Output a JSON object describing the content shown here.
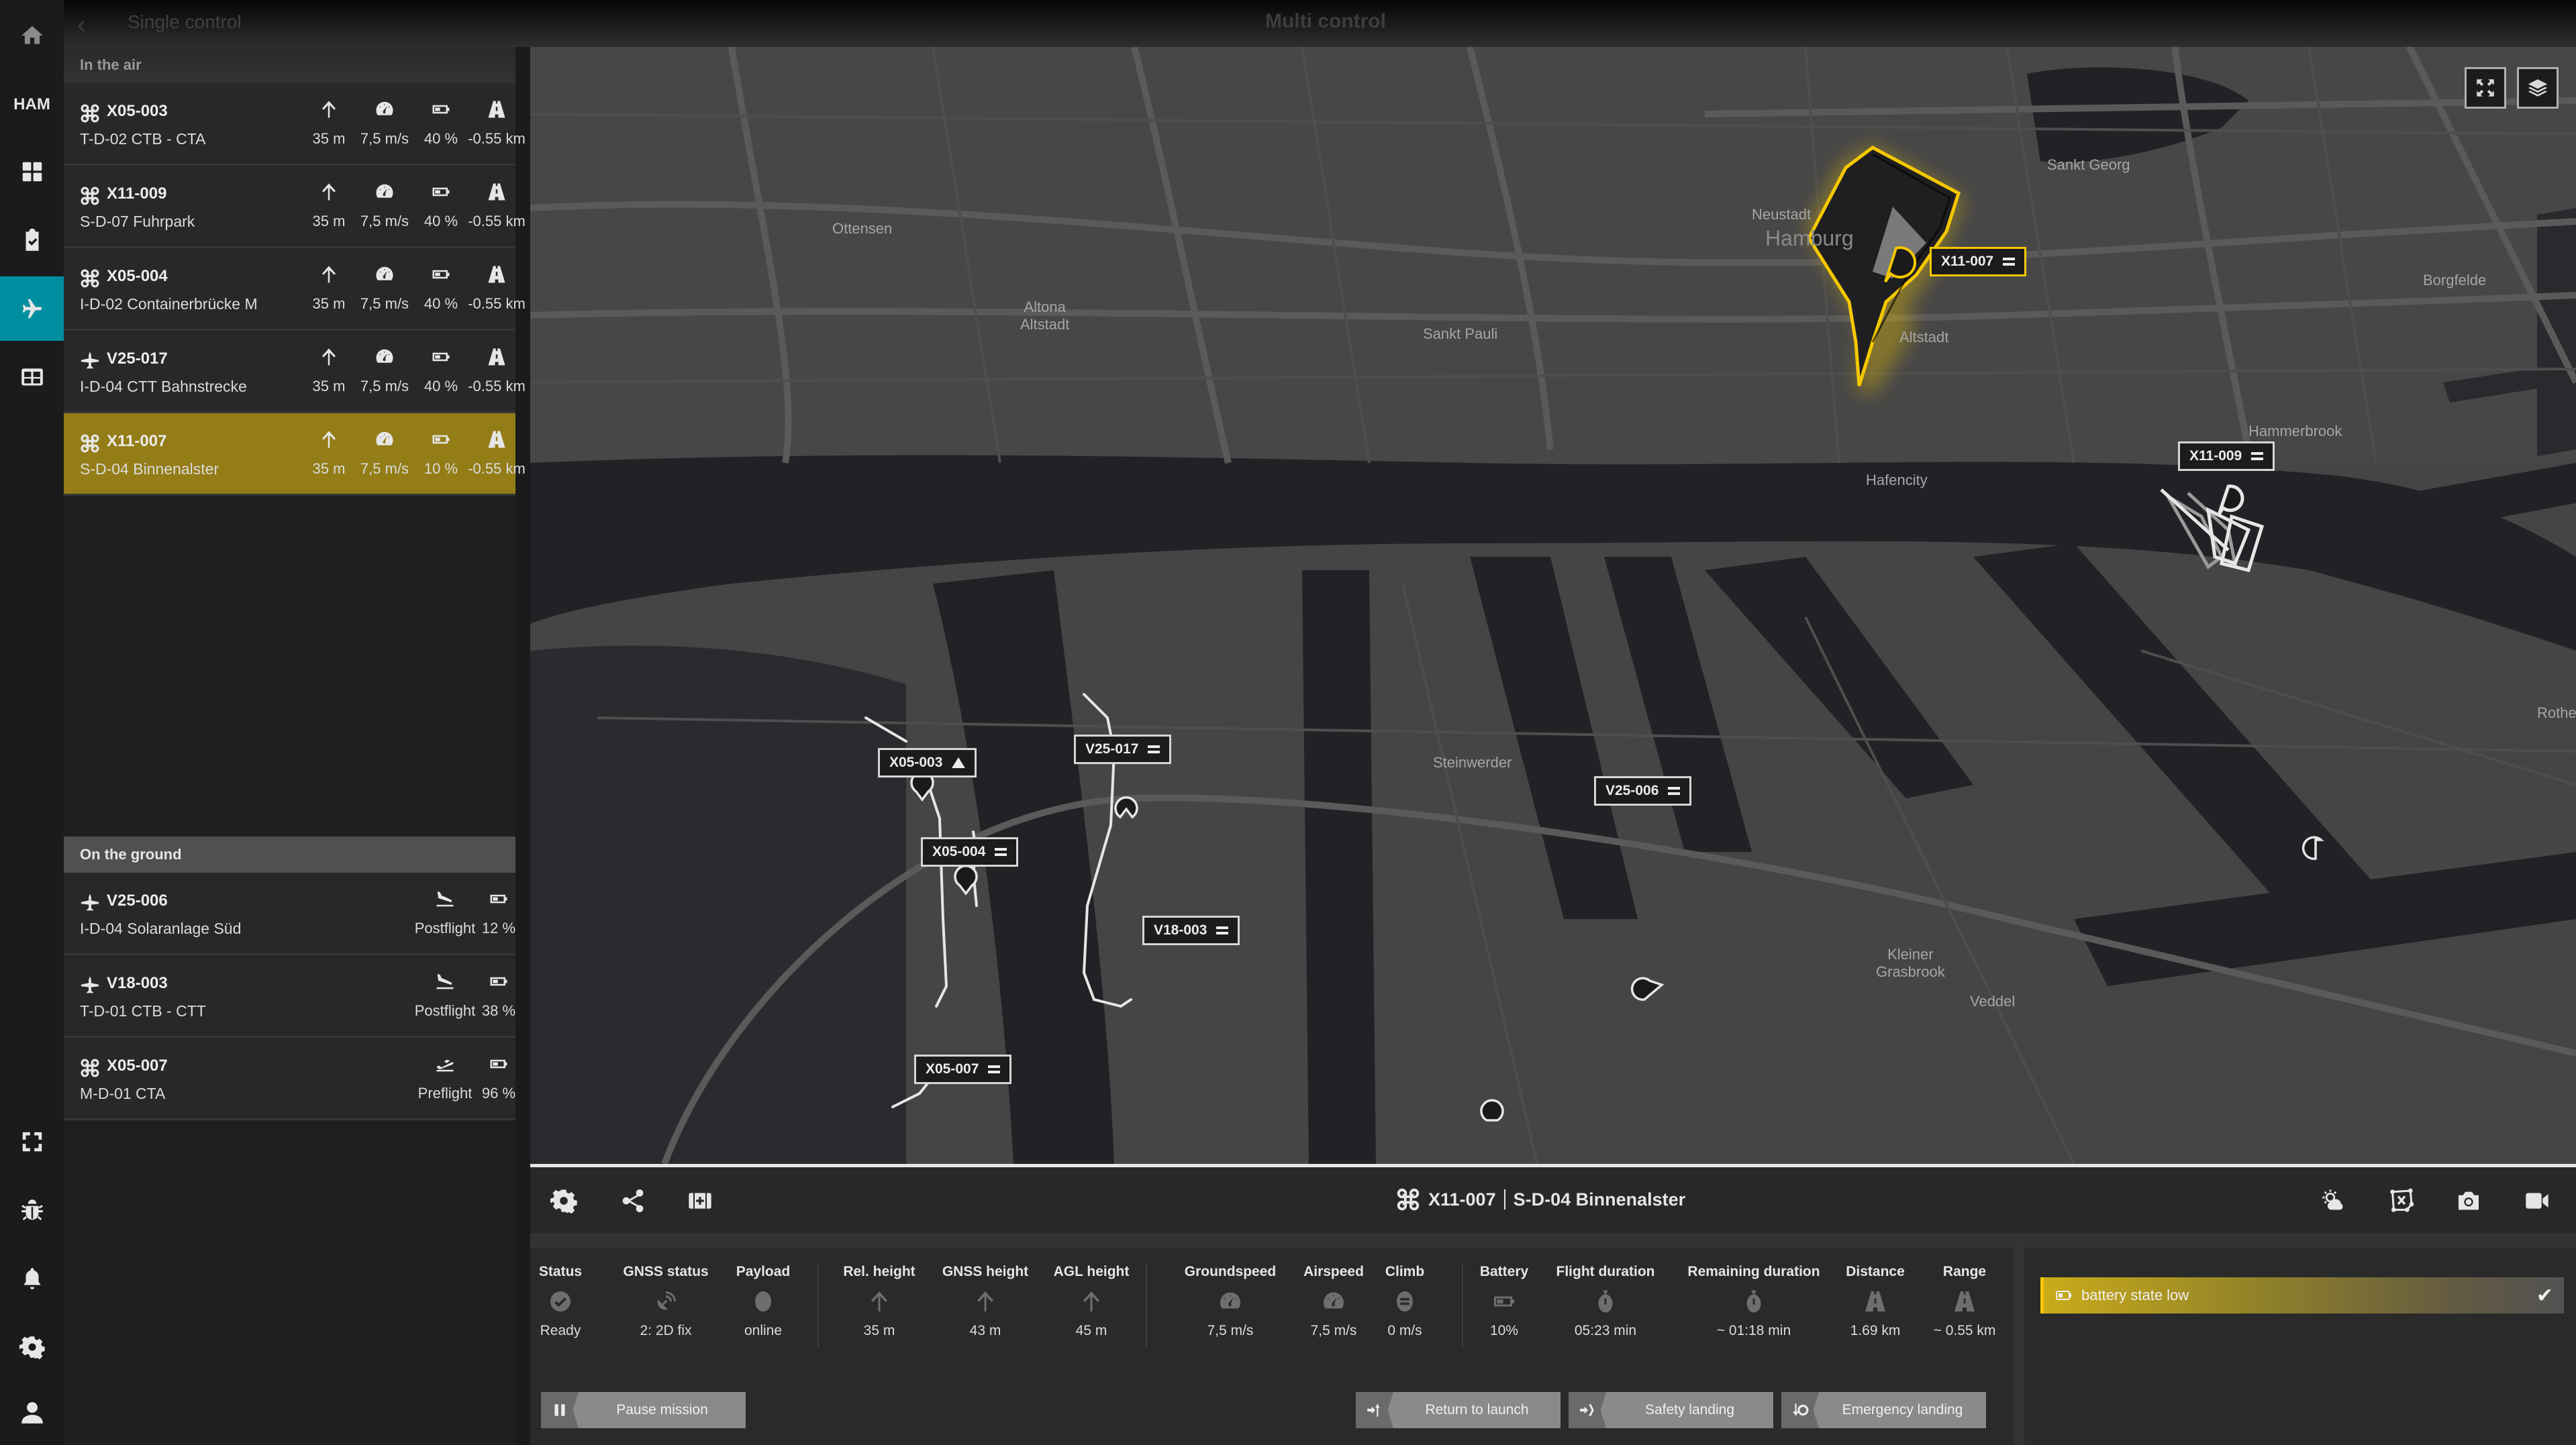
{
  "topbar": {
    "back_label": "Single control",
    "center_title": "Multi control"
  },
  "rail": {
    "location_code": "HAM",
    "items": [
      {
        "name": "home",
        "icon": "home-icon"
      },
      {
        "name": "dashboard",
        "icon": "grid-icon"
      },
      {
        "name": "checklist",
        "icon": "clipboard-check-icon"
      },
      {
        "name": "flights",
        "icon": "airplane-icon",
        "active": true
      },
      {
        "name": "table",
        "icon": "table-icon"
      },
      {
        "name": "fullscreen",
        "icon": "fullscreen-icon"
      },
      {
        "name": "debug",
        "icon": "bug-icon"
      },
      {
        "name": "notifications",
        "icon": "bell-icon"
      },
      {
        "name": "settings",
        "icon": "gear-icon"
      },
      {
        "name": "profile",
        "icon": "user-icon"
      }
    ]
  },
  "sidebar": {
    "air_heading": "In the air",
    "ground_heading": "On the ground",
    "in_air": [
      {
        "id": "X05-003",
        "type": "multicopter",
        "mission": "T-D-02 CTB - CTA",
        "height": "35 m",
        "speed": "7,5 m/s",
        "battery": "40 %",
        "range": "-0.55 km",
        "selected": false
      },
      {
        "id": "X11-009",
        "type": "multicopter",
        "mission": "S-D-07 Fuhrpark",
        "height": "35 m",
        "speed": "7,5 m/s",
        "battery": "40 %",
        "range": "-0.55 km",
        "selected": false
      },
      {
        "id": "X05-004",
        "type": "multicopter",
        "mission": "I-D-02 Containerbrücke M",
        "height": "35 m",
        "speed": "7,5 m/s",
        "battery": "40 %",
        "range": "-0.55 km",
        "selected": false
      },
      {
        "id": "V25-017",
        "type": "vtol",
        "mission": "I-D-04 CTT Bahnstrecke",
        "height": "35 m",
        "speed": "7,5 m/s",
        "battery": "40 %",
        "range": "-0.55 km",
        "selected": false
      },
      {
        "id": "X11-007",
        "type": "multicopter",
        "mission": "S-D-04 Binnenalster",
        "height": "35 m",
        "speed": "7,5 m/s",
        "battery": "10 %",
        "range": "-0.55 km",
        "selected": true
      }
    ],
    "on_ground": [
      {
        "id": "V25-006",
        "type": "vtol",
        "mission": "I-D-04 Solaranlage Süd",
        "phase": "Postflight",
        "phase_icon": "landing-icon",
        "battery": "12 %"
      },
      {
        "id": "V18-003",
        "type": "vtol",
        "mission": "T-D-01 CTB - CTT",
        "phase": "Postflight",
        "phase_icon": "landing-icon",
        "battery": "38 %"
      },
      {
        "id": "X05-007",
        "type": "multicopter",
        "mission": "M-D-01 CTA",
        "phase": "Preflight",
        "phase_icon": "takeoff-icon",
        "battery": "96 %"
      }
    ]
  },
  "map": {
    "places": [
      {
        "name": "Ottensen"
      },
      {
        "name": "Altona\nAltstadt"
      },
      {
        "name": "Sankt Pauli"
      },
      {
        "name": "Neustadt"
      },
      {
        "name": "Hamburg"
      },
      {
        "name": "Altstadt"
      },
      {
        "name": "Sankt Georg"
      },
      {
        "name": "Borgfelde"
      },
      {
        "name": "Hammerbrook"
      },
      {
        "name": "Hafencity"
      },
      {
        "name": "Steinwerder"
      },
      {
        "name": "Kleiner\nGrasbrook"
      },
      {
        "name": "Veddel"
      },
      {
        "name": "Rothenbu"
      }
    ],
    "vehicle_tags": [
      {
        "id": "X11-007",
        "marker": "menu",
        "selected": true
      },
      {
        "id": "X11-009",
        "marker": "menu"
      },
      {
        "id": "X05-003",
        "marker": "warning-triangle"
      },
      {
        "id": "V25-017",
        "marker": "menu"
      },
      {
        "id": "X05-004",
        "marker": "menu"
      },
      {
        "id": "V18-003",
        "marker": "menu"
      },
      {
        "id": "V25-006",
        "marker": "menu"
      },
      {
        "id": "X05-007",
        "marker": "menu"
      }
    ],
    "controls": [
      {
        "name": "fullscreen",
        "icon": "expand-icon"
      },
      {
        "name": "layers",
        "icon": "layers-icon"
      }
    ],
    "highlight_color": "#f5c800"
  },
  "detail": {
    "vehicle_id": "X11-007",
    "mission": "S-D-04 Binnenalster",
    "left_tools": [
      "gear-icon",
      "share-icon",
      "medical-kit-icon"
    ],
    "right_tools": [
      "weather-icon",
      "geofence-icon",
      "camera-icon",
      "video-icon"
    ]
  },
  "telemetry": {
    "groups": [
      [
        {
          "label": "Status",
          "icon": "check-circle-icon",
          "value": "Ready"
        },
        {
          "label": "GNSS status",
          "icon": "satellite-icon",
          "value": "2: 2D fix"
        },
        {
          "label": "Payload",
          "icon": "circle-icon",
          "value": "online"
        }
      ],
      [
        {
          "label": "Rel. height",
          "icon": "arrow-up-icon",
          "value": "35 m"
        },
        {
          "label": "GNSS height",
          "icon": "arrow-up-icon",
          "value": "43 m"
        },
        {
          "label": "AGL height",
          "icon": "arrow-up-icon",
          "value": "45 m"
        }
      ],
      [
        {
          "label": "Groundspeed",
          "icon": "speedometer-icon",
          "value": "7,5 m/s"
        },
        {
          "label": "Airspeed",
          "icon": "speedometer-icon",
          "value": "7,5 m/s"
        },
        {
          "label": "Climb",
          "icon": "climb-icon",
          "value": "0 m/s"
        }
      ],
      [
        {
          "label": "Battery",
          "icon": "battery-icon",
          "value": "10%"
        },
        {
          "label": "Flight duration",
          "icon": "stopwatch-icon",
          "value": "05:23 min"
        },
        {
          "label": "Remaining duration",
          "icon": "stopwatch-icon",
          "value": "~ 01:18 min"
        },
        {
          "label": "Distance",
          "icon": "road-icon",
          "value": "1.69 km"
        },
        {
          "label": "Range",
          "icon": "road-icon",
          "value": "~ 0.55 km"
        }
      ]
    ]
  },
  "actions": {
    "pause": "Pause mission",
    "rtl": "Return to launch",
    "safety": "Safety landing",
    "emergency": "Emergency landing"
  },
  "alerts": [
    {
      "text": "battery state low",
      "icon": "battery-low-icon",
      "color": "#f5c800"
    }
  ]
}
